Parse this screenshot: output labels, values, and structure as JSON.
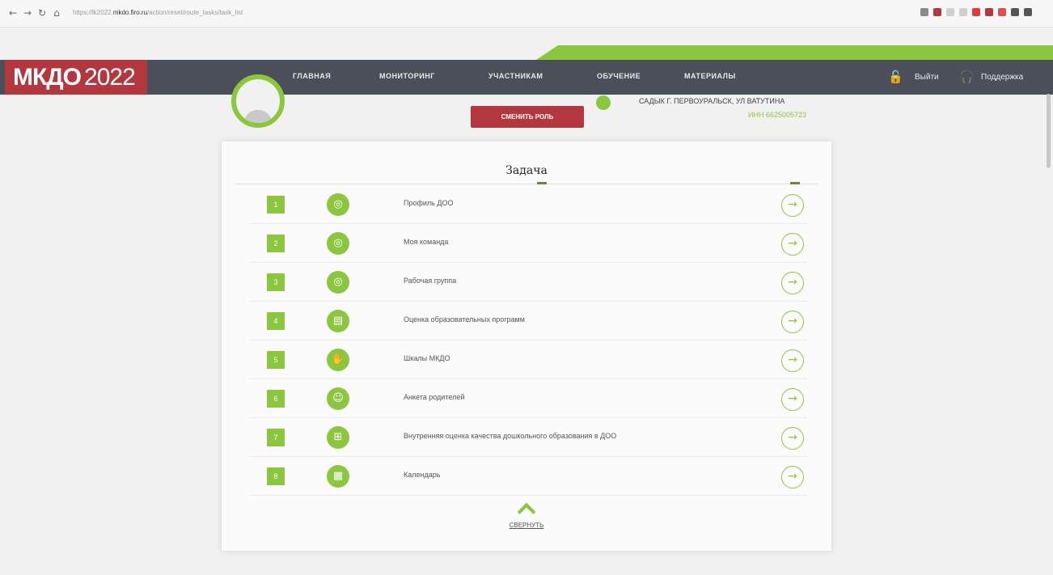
{
  "colors": {
    "accent": "#8cc63f",
    "brand": "#b3373e",
    "header": "#4a4f59"
  },
  "browser": {
    "back_icon": "arrow-left-icon",
    "forward_icon": "arrow-right-icon",
    "reload_icon": "reload-icon",
    "home_icon": "home-icon",
    "url_prefix": "https://lk2022.",
    "url_domain": "mkdo.firo.ru",
    "url_rest": "/action/reset/route_tasks/task_list"
  },
  "header": {
    "logo_main": "МКДО",
    "logo_year": "2022",
    "menu": [
      "ГЛАВНАЯ",
      "МОНИТОРИНГ",
      "УЧАСТНИКАМ",
      "ОБУЧЕНИЕ",
      "МАТЕРИАЛЫ"
    ],
    "logout": "Выйти",
    "support": "Поддержка"
  },
  "profile": {
    "change_role": "СМЕНИТЬ РОЛЬ",
    "org_name": "САДЫК Г. ПЕРВОУРАЛЬСК, УЛ ВАТУТИНА",
    "org_id": "ИНН 6625005723"
  },
  "panel": {
    "title": "Задача",
    "collapse_label": "СВЕРНУТЬ",
    "rows": [
      {
        "num": "1",
        "label": "Профиль ДОО",
        "icon": "profile-icon"
      },
      {
        "num": "2",
        "label": "Моя команда",
        "icon": "team-icon"
      },
      {
        "num": "3",
        "label": "Рабочая группа",
        "icon": "group-icon"
      },
      {
        "num": "4",
        "label": "Оценка образовательных программ",
        "icon": "document-icon"
      },
      {
        "num": "5",
        "label": "Шкалы МКДО",
        "icon": "scale-icon"
      },
      {
        "num": "6",
        "label": "Анкета родителей",
        "icon": "survey-icon"
      },
      {
        "num": "7",
        "label": "Внутренняя оценка качества дошкольного образования в ДОО",
        "icon": "evaluation-icon"
      },
      {
        "num": "8",
        "label": "Календарь",
        "icon": "calendar-icon"
      }
    ]
  }
}
